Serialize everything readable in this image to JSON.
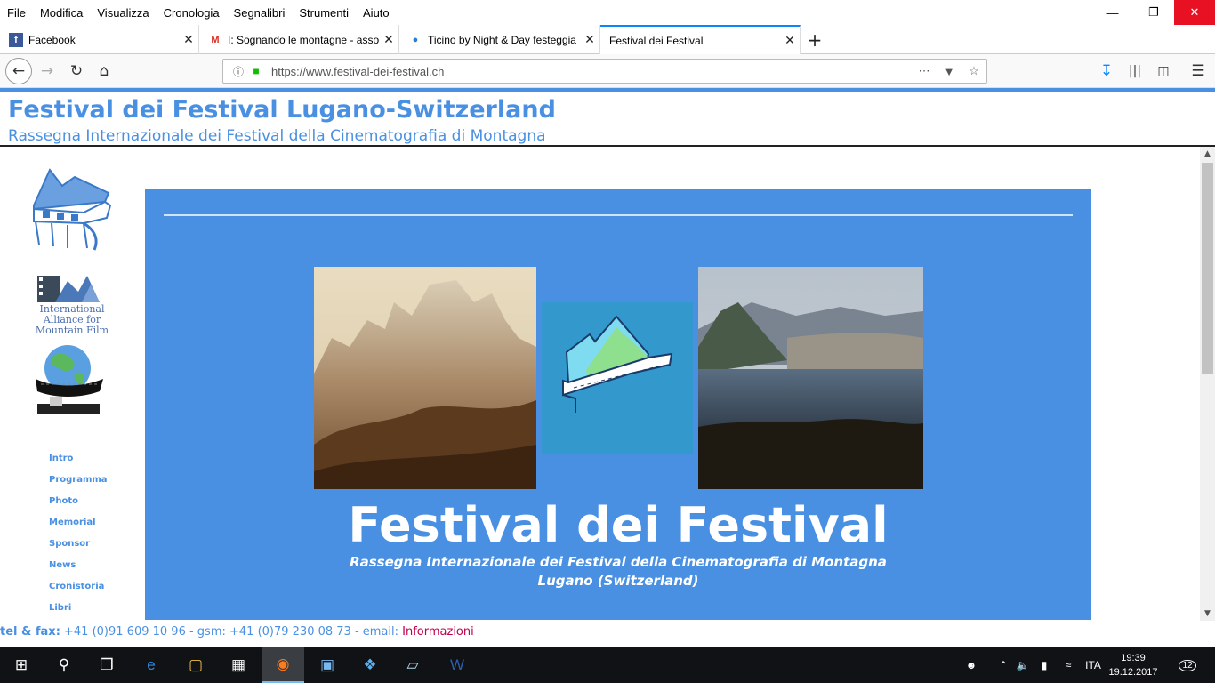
{
  "menubar": {
    "items": [
      "File",
      "Modifica",
      "Visualizza",
      "Cronologia",
      "Segnalibri",
      "Strumenti",
      "Aiuto"
    ]
  },
  "tabs": [
    {
      "title": "Facebook",
      "icon": "facebook-icon",
      "active": false
    },
    {
      "title": "I: Sognando le montagne - asso",
      "icon": "gmail-icon",
      "active": false
    },
    {
      "title": "Ticino by Night & Day festeggia",
      "icon": "ticino-icon",
      "active": false
    },
    {
      "title": "Festival dei Festival",
      "icon": "none",
      "active": true
    }
  ],
  "urlbar": {
    "url": "https://www.festival-dei-festival.ch"
  },
  "site": {
    "title": "Festival dei Festival Lugano-Switzerland",
    "subtitle": "Rassegna Internazionale dei Festival della Cinematografia di Montagna",
    "alliance_text": "International Alliance for Mountain Film"
  },
  "sidenav": [
    "Intro",
    "Programma",
    "Photo",
    "Memorial",
    "Sponsor",
    "News",
    "Cronistoria",
    "Libri"
  ],
  "hero": {
    "title": "Festival dei Festival",
    "subtitle_line1": "Rassegna Internazionale dei Festival della Cinematografia di Montagna",
    "subtitle_line2": "Lugano (Switzerland)"
  },
  "contact": {
    "label": "tel & fax:",
    "details": " +41 (0)91 609 10 96 - gsm: +41 (0)79 230 08 73 - email: ",
    "link": "Informazioni"
  },
  "taskbar": {
    "language": "ITA",
    "time": "19:39",
    "date": "19.12.2017",
    "notifications": "12"
  },
  "colors": {
    "accent": "#4a90e2",
    "link": "#c0004a",
    "hero_bg": "#4a90e2",
    "center_logo_bg": "#3399cc"
  }
}
